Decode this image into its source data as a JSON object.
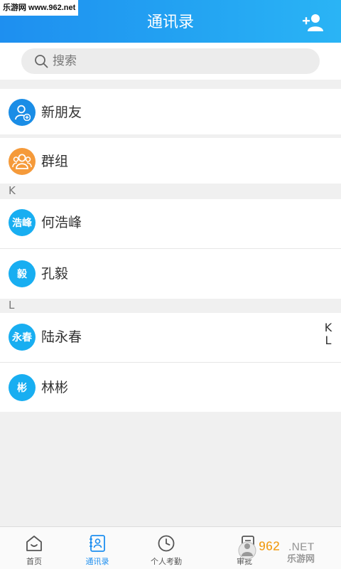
{
  "watermark_top": "乐游网 www.962.net",
  "header": {
    "title": "通讯录"
  },
  "search": {
    "placeholder": "搜索"
  },
  "specials": [
    {
      "label": "新朋友",
      "icon": "add-person-icon"
    },
    {
      "label": "群组",
      "icon": "group-icon"
    }
  ],
  "sections": [
    {
      "letter": "K",
      "contacts": [
        {
          "avatar": "浩峰",
          "name": "何浩峰"
        },
        {
          "avatar": "毅",
          "name": "孔毅"
        }
      ]
    },
    {
      "letter": "L",
      "contacts": [
        {
          "avatar": "永春",
          "name": "陆永春"
        },
        {
          "avatar": "彬",
          "name": "林彬"
        }
      ]
    }
  ],
  "index_bar": [
    "K",
    "L"
  ],
  "tabs": [
    {
      "label": "首页",
      "icon": "home-icon"
    },
    {
      "label": "通讯录",
      "icon": "contacts-icon",
      "active": true
    },
    {
      "label": "个人考勤",
      "icon": "clock-icon"
    },
    {
      "label": "审批",
      "icon": "approval-icon"
    }
  ],
  "watermark_bottom": "962.NET 乐游网",
  "colors": {
    "header": "#1e8ff0",
    "accent": "#18aef1",
    "orange": "#f59a3a"
  }
}
